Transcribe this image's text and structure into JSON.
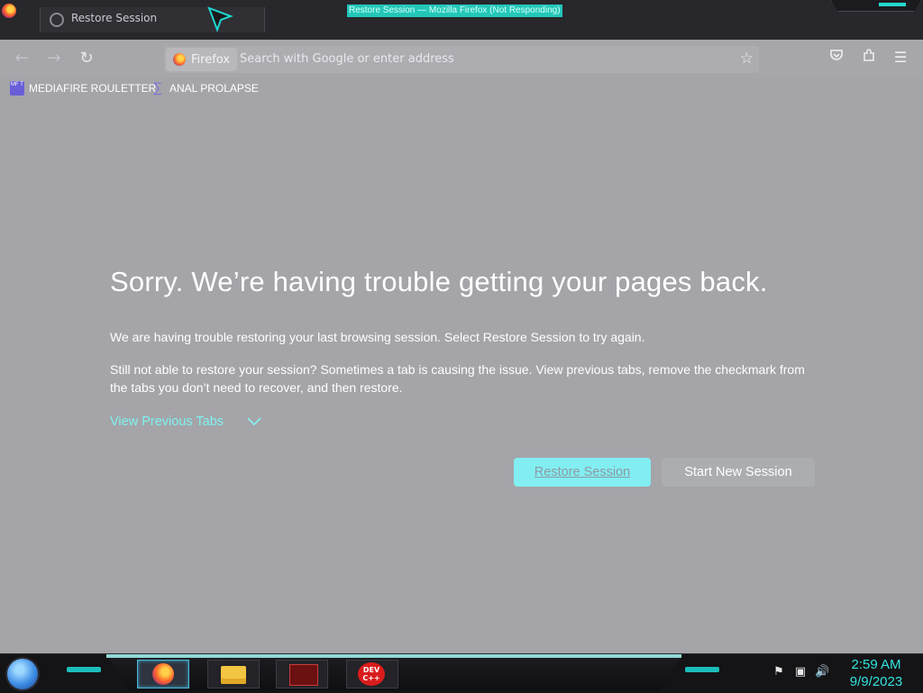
{
  "window": {
    "title": "Restore Session — Mozilla Firefox (Not Responding)"
  },
  "tab": {
    "title": "Restore Session"
  },
  "navbar": {
    "identity_label": "Firefox",
    "search_placeholder": "Search with Google or enter address"
  },
  "bookmarks": [
    {
      "label": "MEDIAFIRE ROULETTER",
      "icon_text": "MF T"
    },
    {
      "label": "ANAL PROLAPSE"
    }
  ],
  "page": {
    "heading": "Sorry. We’re having trouble getting your pages back.",
    "paragraph1": "We are having trouble restoring your last browsing session. Select Restore Session to try again.",
    "paragraph2": "Still not able to restore your session? Sometimes a tab is causing the issue. View previous tabs, remove the checkmark from the tabs you don’t need to recover, and then restore.",
    "view_previous_tabs": "View Previous Tabs",
    "restore_button": "Restore Session",
    "new_session_button": "Start New Session"
  },
  "taskbar": {
    "dev_icon_text": "DEV C++",
    "clock_time": "2:59 AM",
    "clock_date": "9/9/2023"
  },
  "colors": {
    "accent_cyan": "#82eef2",
    "link_cyan": "#7ff2ef",
    "page_bg": "#a4a4a9"
  }
}
